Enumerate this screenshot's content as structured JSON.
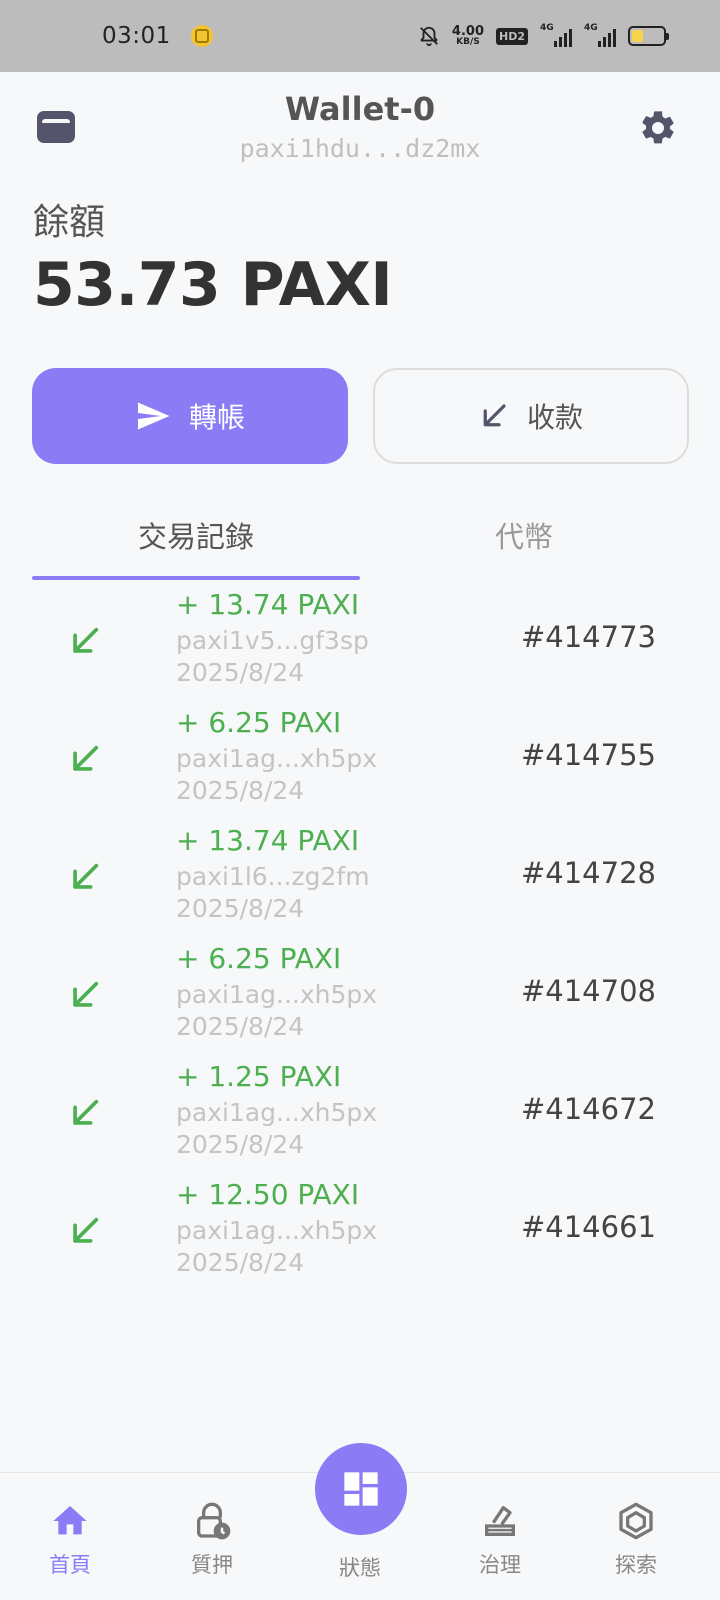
{
  "status_bar": {
    "time": "03:01",
    "net_speed_value": "4.00",
    "net_speed_unit": "KB/S",
    "hd_badge": "HD2",
    "signal1_tag": "4G",
    "signal2_tag": "4G",
    "battery_level": 0.35
  },
  "header": {
    "title": "Wallet-0",
    "address": "paxi1hdu...dz2mx"
  },
  "balance": {
    "label": "餘額",
    "value": "53.73 PAXI"
  },
  "actions": {
    "send_label": "轉帳",
    "receive_label": "收款"
  },
  "tabs": {
    "history": "交易記錄",
    "tokens": "代幣"
  },
  "transactions": [
    {
      "amount": "+ 13.74 PAXI",
      "address": "paxi1v5...gf3sp",
      "date": "2025/8/24",
      "block": "#414773"
    },
    {
      "amount": "+ 6.25 PAXI",
      "address": "paxi1ag...xh5px",
      "date": "2025/8/24",
      "block": "#414755"
    },
    {
      "amount": "+ 13.74 PAXI",
      "address": "paxi1l6...zg2fm",
      "date": "2025/8/24",
      "block": "#414728"
    },
    {
      "amount": "+ 6.25 PAXI",
      "address": "paxi1ag...xh5px",
      "date": "2025/8/24",
      "block": "#414708"
    },
    {
      "amount": "+ 1.25 PAXI",
      "address": "paxi1ag...xh5px",
      "date": "2025/8/24",
      "block": "#414672"
    },
    {
      "amount": "+ 12.50 PAXI",
      "address": "paxi1ag...xh5px",
      "date": "2025/8/24",
      "block": "#414661"
    }
  ],
  "nav": {
    "home": "首頁",
    "stake": "質押",
    "status": "狀態",
    "governance": "治理",
    "explore": "探索"
  },
  "colors": {
    "accent": "#8b7cf6",
    "incoming": "#4caf50"
  }
}
